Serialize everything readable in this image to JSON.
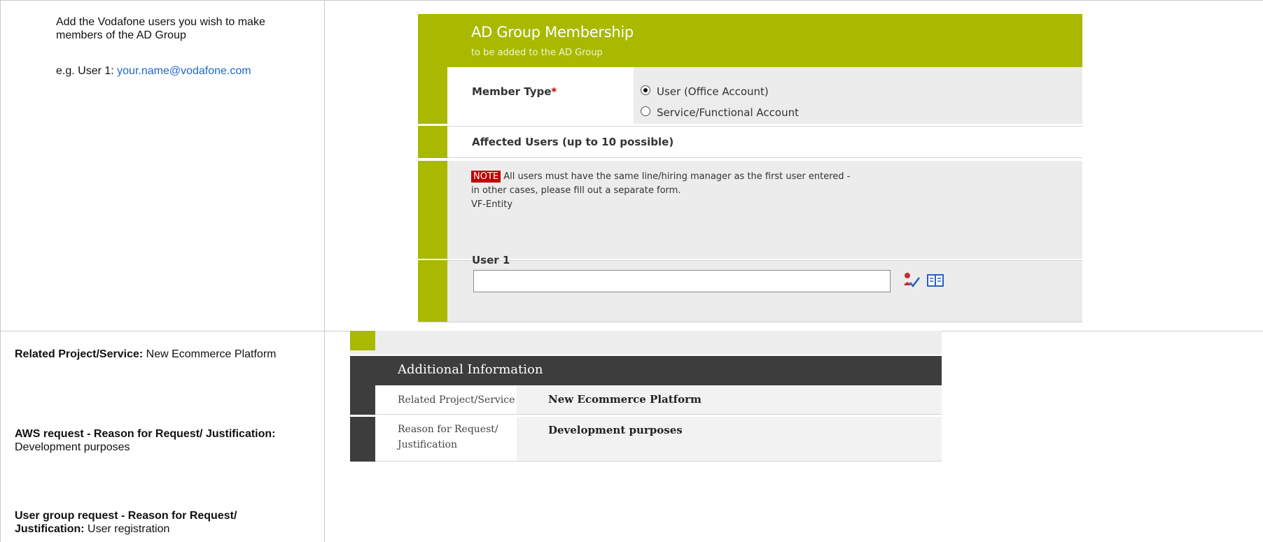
{
  "left_column": {
    "instruction_line1": "Add the Vodafone users you wish to make members of the AD Group",
    "example_prefix": "e.g. User 1: ",
    "example_email": "your.name@vodafone.com",
    "related_project_label": "Related Project/Service:",
    "related_project_value": " New Ecommerce Platform",
    "aws_label": "AWS request - Reason for Request/ Justification:",
    "aws_value": " Development purposes",
    "usergroup_label": "User group request - Reason for Request/ Justification:",
    "usergroup_value": " User registration"
  },
  "ad_form": {
    "title": "AD Group Membership",
    "subtitle": "to be added to the AD Group",
    "member_type_label": "Member Type",
    "required_mark": "*",
    "option_user": "User (Office Account)",
    "option_service": "Service/Functional Account",
    "selected_option": "User (Office Account)",
    "affected_users_label": "Affected Users (up to 10 possible)",
    "note_tag": "NOTE",
    "note_line1": " All users must have the same line/hiring manager as the first user entered -",
    "note_line2": "in other cases, please fill out a separate form.",
    "note_line3": "VF-Entity",
    "user1_label": "User 1",
    "user1_value": "",
    "colors": {
      "accent": "#a8b900",
      "required": "#c00000"
    }
  },
  "additional_info": {
    "title": "Additional Information",
    "rows": [
      {
        "label": "Related Project/Service",
        "value": "New Ecommerce Platform"
      },
      {
        "label": "Reason for Request/ Justification",
        "value": "Development purposes"
      }
    ],
    "colors": {
      "header": "#3d3d3d"
    }
  }
}
